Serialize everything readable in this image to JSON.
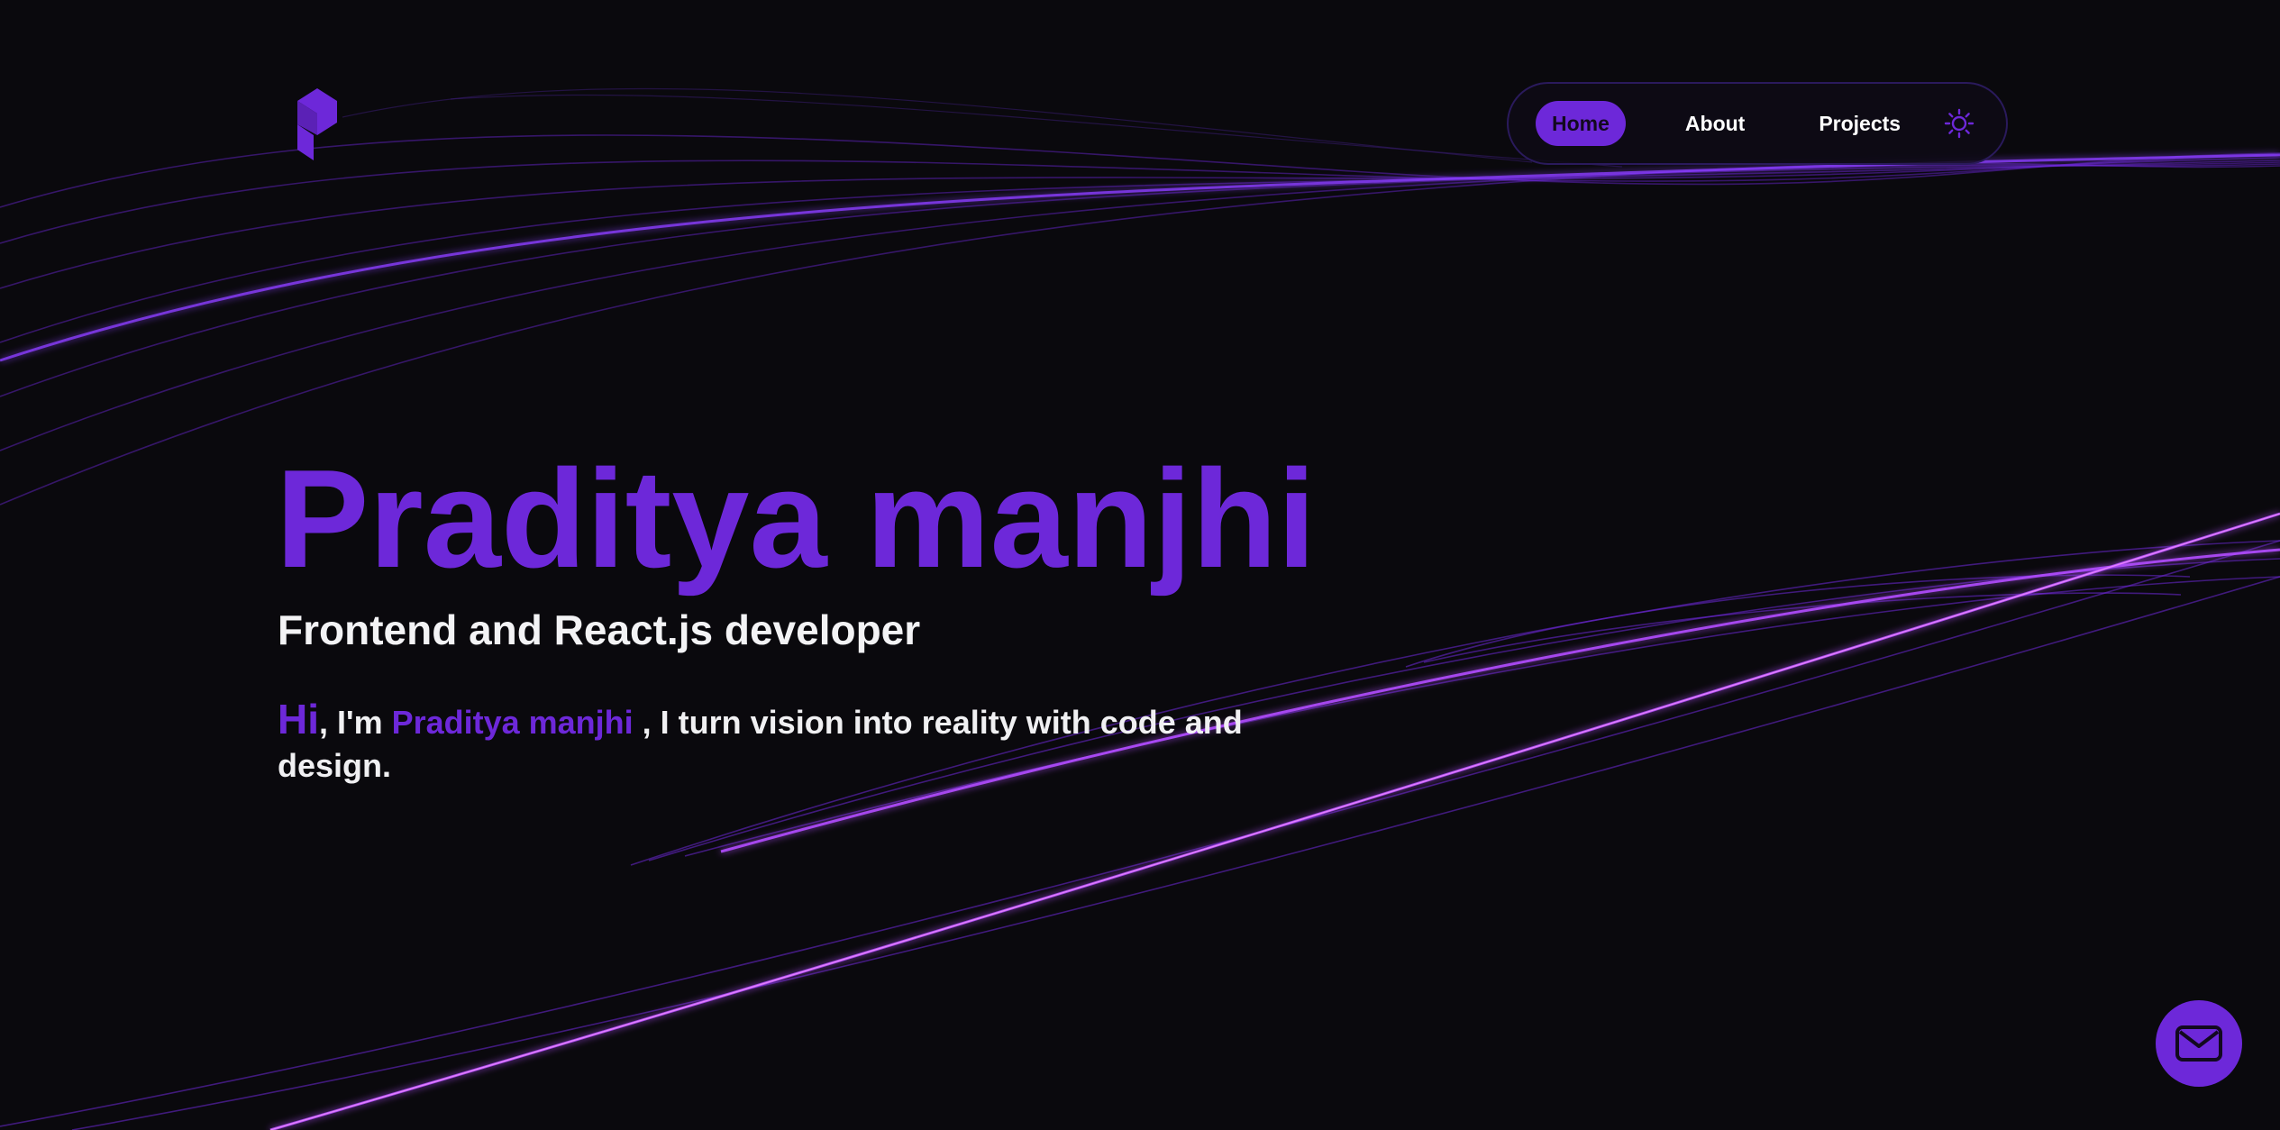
{
  "nav": {
    "items": [
      {
        "label": "Home",
        "active": true
      },
      {
        "label": "About",
        "active": false
      },
      {
        "label": "Projects",
        "active": false
      }
    ],
    "theme_toggle_icon": "sun-icon"
  },
  "hero": {
    "name": "Praditya manjhi",
    "role": "Frontend and React.js developer",
    "intro": {
      "hi": "Hi",
      "pre": ", I'm ",
      "name": "Praditya manjhi",
      "post": " , I turn vision into reality with code and design."
    }
  },
  "contact": {
    "icon": "mail-icon"
  },
  "colors": {
    "background": "#0a090d",
    "accent": "#6d28d9",
    "glow": "#c04dff",
    "text": "#f3f3f5"
  }
}
